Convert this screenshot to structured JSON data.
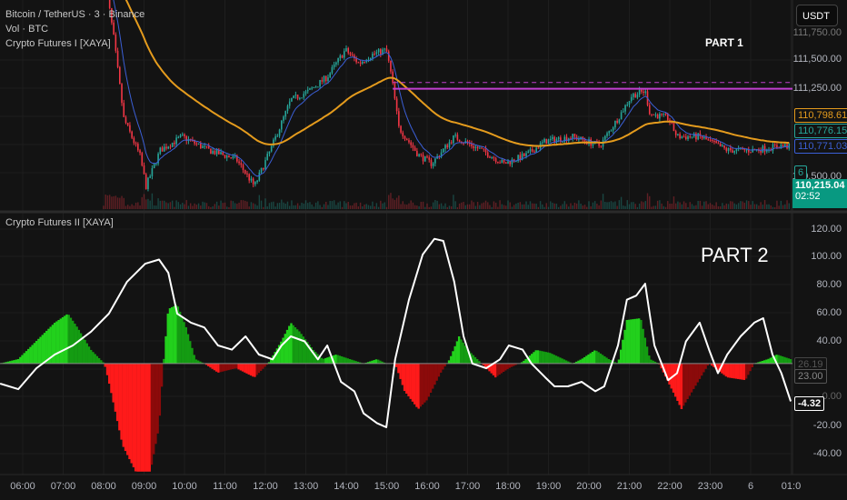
{
  "header": {
    "symbol_line": "Bitcoin / TetherUS · 3 · Binance",
    "volume_line": "Vol · BTC",
    "indicator1": "Crypto Futures I [XAYA]",
    "indicator2": "Crypto Futures II [XAYA]",
    "currency_button": "USDT",
    "part1": "PART 1",
    "part2": "PART 2"
  },
  "colors": {
    "up": "#26a69a",
    "down": "#f23645",
    "ema_slow": "#e49b1d",
    "ema_fast": "#3b5fd6",
    "level": "#c13fd0",
    "osc_line": "#ffffff",
    "hist_up": "#22d11c",
    "hist_up_dark": "#149c12",
    "hist_down": "#ff1a1a",
    "hist_down_dark": "#8c0a0a",
    "bg": "#131313"
  },
  "price_axis": {
    "ticks": [
      "111,750.00",
      "111,500.00",
      "111,250.00",
      "110,500.00"
    ],
    "tags": {
      "ema_slow": "110,798.61",
      "close_ema": "110,776.15",
      "ema_fast": "110,771.03",
      "count": "6",
      "last_price": "110,215.04",
      "countdown": "02:52"
    }
  },
  "osc_axis": {
    "ticks": [
      "120.00",
      "100.00",
      "80.00",
      "60.00",
      "40.00",
      "0.00",
      "-20.00",
      "-40.00"
    ],
    "tags": {
      "hist_value": "26.19",
      "baseline": "23.00",
      "osc_value": "-4.32"
    }
  },
  "time_axis": [
    "06:00",
    "07:00",
    "08:00",
    "09:00",
    "10:00",
    "11:00",
    "12:00",
    "13:00",
    "14:00",
    "15:00",
    "16:00",
    "17:00",
    "18:00",
    "19:00",
    "20:00",
    "21:00",
    "22:00",
    "23:00",
    "6",
    "01:0"
  ],
  "chart_data": [
    {
      "type": "candlestick",
      "title": "Bitcoin / TetherUS · 3 · Binance",
      "x_unit": "hours since 06:00",
      "ylim": [
        110150,
        112000
      ],
      "close_path": [
        [
          2.0,
          112300
        ],
        [
          2.25,
          111700
        ],
        [
          2.5,
          110980
        ],
        [
          2.9,
          110650
        ],
        [
          3.05,
          110380
        ],
        [
          3.4,
          110700
        ],
        [
          3.94,
          110820
        ],
        [
          4.6,
          110700
        ],
        [
          5.28,
          110620
        ],
        [
          5.73,
          110380
        ],
        [
          6.17,
          110740
        ],
        [
          6.63,
          111145
        ],
        [
          7.08,
          111225
        ],
        [
          7.53,
          111350
        ],
        [
          7.98,
          111590
        ],
        [
          8.31,
          111470
        ],
        [
          8.65,
          111550
        ],
        [
          8.99,
          111590
        ],
        [
          9.12,
          111350
        ],
        [
          9.3,
          110900
        ],
        [
          9.78,
          110660
        ],
        [
          10.11,
          110580
        ],
        [
          10.67,
          110820
        ],
        [
          11.35,
          110700
        ],
        [
          11.9,
          110580
        ],
        [
          12.47,
          110660
        ],
        [
          12.92,
          110780
        ],
        [
          13.6,
          110820
        ],
        [
          14.27,
          110740
        ],
        [
          14.72,
          110984
        ],
        [
          15.06,
          111185
        ],
        [
          15.39,
          111225
        ],
        [
          15.51,
          111024
        ],
        [
          15.96,
          110984
        ],
        [
          16.18,
          110820
        ],
        [
          16.74,
          110820
        ],
        [
          17.42,
          110700
        ],
        [
          18.09,
          110700
        ],
        [
          18.76,
          110740
        ],
        [
          19.0,
          110730
        ]
      ],
      "levels": [
        {
          "price": 111245,
          "style": "solid",
          "from": 9.15
        },
        {
          "price": 111300,
          "style": "dashed",
          "from": 9.15
        }
      ],
      "ema_periods": [
        9,
        60
      ]
    },
    {
      "type": "area",
      "title": "Crypto Futures II [XAYA]",
      "ylim": [
        -55,
        125
      ],
      "baseline": 23,
      "histogram": [
        [
          -0.56,
          23
        ],
        [
          -0.11,
          26.2
        ],
        [
          0.34,
          39.3
        ],
        [
          0.79,
          52.4
        ],
        [
          1.12,
          59
        ],
        [
          1.35,
          49.2
        ],
        [
          1.69,
          32.8
        ],
        [
          2.02,
          23
        ],
        [
          2.13,
          9.8
        ],
        [
          2.47,
          -36
        ],
        [
          2.81,
          -56
        ],
        [
          3.15,
          -56
        ],
        [
          3.37,
          -23
        ],
        [
          3.48,
          23
        ],
        [
          3.6,
          62.3
        ],
        [
          3.82,
          65.6
        ],
        [
          4.04,
          49.2
        ],
        [
          4.27,
          26.2
        ],
        [
          4.49,
          23
        ],
        [
          4.83,
          16.4
        ],
        [
          5.28,
          19.6
        ],
        [
          5.73,
          13
        ],
        [
          6.07,
          23
        ],
        [
          6.4,
          39.3
        ],
        [
          6.63,
          52.4
        ],
        [
          6.85,
          45.9
        ],
        [
          7.19,
          32.8
        ],
        [
          7.42,
          26.2
        ],
        [
          7.75,
          29.5
        ],
        [
          8.09,
          26.2
        ],
        [
          8.43,
          23
        ],
        [
          8.76,
          26.2
        ],
        [
          8.99,
          23
        ],
        [
          9.21,
          23
        ],
        [
          9.44,
          3.2
        ],
        [
          9.78,
          -9.9
        ],
        [
          10.0,
          -3.3
        ],
        [
          10.34,
          16.4
        ],
        [
          10.56,
          26.2
        ],
        [
          10.79,
          42.6
        ],
        [
          11.01,
          32.8
        ],
        [
          11.35,
          23
        ],
        [
          11.69,
          13
        ],
        [
          12.02,
          19.6
        ],
        [
          12.36,
          24.2
        ],
        [
          12.7,
          32.8
        ],
        [
          13.03,
          30.8
        ],
        [
          13.37,
          26.2
        ],
        [
          13.6,
          23
        ],
        [
          13.82,
          26.2
        ],
        [
          14.16,
          32.8
        ],
        [
          14.49,
          26.2
        ],
        [
          14.72,
          23
        ],
        [
          14.94,
          54.4
        ],
        [
          15.28,
          55.7
        ],
        [
          15.51,
          26.2
        ],
        [
          15.73,
          23
        ],
        [
          16.07,
          3.2
        ],
        [
          16.29,
          -9.9
        ],
        [
          16.63,
          6.5
        ],
        [
          16.97,
          23
        ],
        [
          17.42,
          13
        ],
        [
          17.87,
          11
        ],
        [
          18.09,
          23
        ],
        [
          18.43,
          26.2
        ],
        [
          18.65,
          29.5
        ],
        [
          18.99,
          26.2
        ]
      ],
      "line": [
        [
          -0.56,
          8.5
        ],
        [
          -0.11,
          4.5
        ],
        [
          0.34,
          19.6
        ],
        [
          0.79,
          29.5
        ],
        [
          1.24,
          36
        ],
        [
          1.69,
          46
        ],
        [
          2.13,
          59
        ],
        [
          2.58,
          82
        ],
        [
          3.03,
          95
        ],
        [
          3.37,
          98
        ],
        [
          3.6,
          88.5
        ],
        [
          3.82,
          59
        ],
        [
          4.16,
          52.5
        ],
        [
          4.49,
          49
        ],
        [
          4.83,
          36
        ],
        [
          5.17,
          33
        ],
        [
          5.51,
          42.6
        ],
        [
          5.84,
          29.5
        ],
        [
          6.18,
          26
        ],
        [
          6.4,
          36
        ],
        [
          6.63,
          42.6
        ],
        [
          6.97,
          39
        ],
        [
          7.3,
          26
        ],
        [
          7.53,
          36
        ],
        [
          7.87,
          9.8
        ],
        [
          8.2,
          3
        ],
        [
          8.43,
          -13
        ],
        [
          8.76,
          -20
        ],
        [
          8.99,
          -23
        ],
        [
          9.21,
          26
        ],
        [
          9.55,
          69
        ],
        [
          9.89,
          101.6
        ],
        [
          10.18,
          113
        ],
        [
          10.4,
          111.5
        ],
        [
          10.67,
          82
        ],
        [
          10.9,
          42.6
        ],
        [
          11.12,
          23
        ],
        [
          11.46,
          19.6
        ],
        [
          11.8,
          26
        ],
        [
          12.02,
          36
        ],
        [
          12.36,
          33
        ],
        [
          12.58,
          23
        ],
        [
          12.92,
          13
        ],
        [
          13.15,
          6.5
        ],
        [
          13.48,
          6.5
        ],
        [
          13.82,
          9.8
        ],
        [
          14.16,
          3
        ],
        [
          14.38,
          6.5
        ],
        [
          14.72,
          36
        ],
        [
          14.94,
          69
        ],
        [
          15.17,
          72
        ],
        [
          15.39,
          80.6
        ],
        [
          15.62,
          36
        ],
        [
          15.96,
          11
        ],
        [
          16.18,
          16
        ],
        [
          16.4,
          39
        ],
        [
          16.74,
          52.5
        ],
        [
          16.97,
          33
        ],
        [
          17.19,
          16
        ],
        [
          17.42,
          29.5
        ],
        [
          17.75,
          42.6
        ],
        [
          18.09,
          52.5
        ],
        [
          18.31,
          55.7
        ],
        [
          18.54,
          29.5
        ],
        [
          18.76,
          16
        ],
        [
          18.99,
          -4.32
        ]
      ]
    }
  ]
}
